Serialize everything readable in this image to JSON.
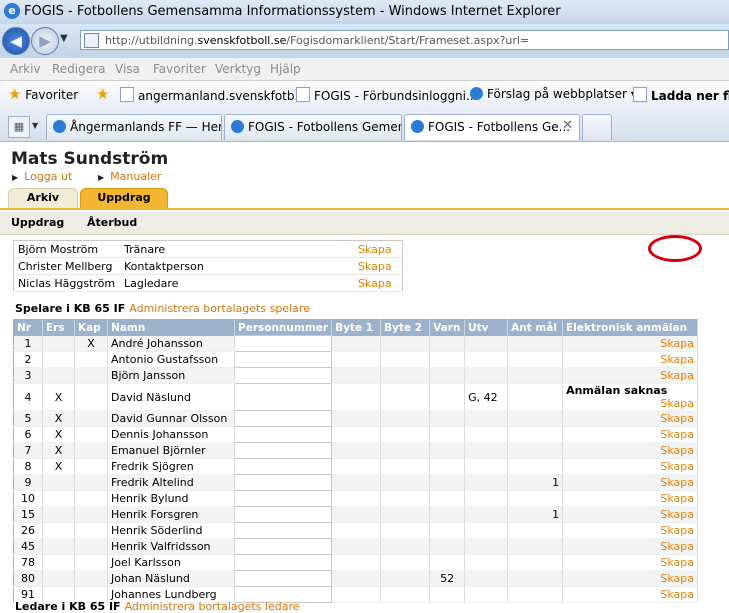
{
  "window": {
    "title": "FOGIS - Fotbollens Gemensamma Informationssystem - Windows Internet Explorer"
  },
  "address": {
    "prefix": "http://utbildning.",
    "domain": "svenskfotboll.se",
    "path": "/Fogisdomarklient/Start/Frameset.aspx?url="
  },
  "menu": [
    "Arkiv",
    "Redigera",
    "Visa",
    "Favoriter",
    "Verktyg",
    "Hjälp"
  ],
  "favorites": {
    "label": "Favoriter",
    "items": [
      "angermanland.svenskfotb...",
      "FOGIS - Förbundsinloggni...",
      "Förslag på webbplatser ▾",
      "Ladda ner fler"
    ]
  },
  "tabs": [
    "Ångermanlands FF — Hem",
    "FOGIS - Fotbollens Gemen...",
    "FOGIS - Fotbollens Ge..."
  ],
  "page": {
    "user_name": "Mats Sundström",
    "logout": "Logga ut",
    "manuals": "Manualer",
    "tab_arkiv": "Arkiv",
    "tab_uppdrag": "Uppdrag",
    "subnav": [
      "Uppdrag",
      "Återbud"
    ],
    "staff": [
      {
        "name": "Björn Moström",
        "role": "Tränare",
        "action": "Skapa"
      },
      {
        "name": "Christer Mellberg",
        "role": "Kontaktperson",
        "action": "Skapa"
      },
      {
        "name": "Niclas Häggström",
        "role": "Lagledare",
        "action": "Skapa"
      }
    ],
    "players_heading": "Spelare i KB 65 IF",
    "players_admin": "Administrera bortalagets spelare",
    "columns": [
      "Nr",
      "Ers",
      "Kap",
      "Namn",
      "Personnummer",
      "Byte 1",
      "Byte 2",
      "Varn",
      "Utv",
      "Ant mål",
      "Elektronisk anmälan"
    ],
    "players": [
      {
        "nr": "1",
        "ers": "",
        "kap": "X",
        "namn": "André Johansson",
        "varn": "",
        "utv": "",
        "mal": "",
        "anm": "",
        "action": "Skapa"
      },
      {
        "nr": "2",
        "ers": "",
        "kap": "",
        "namn": "Antonio Gustafsson",
        "varn": "",
        "utv": "",
        "mal": "",
        "anm": "",
        "action": "Skapa"
      },
      {
        "nr": "3",
        "ers": "",
        "kap": "",
        "namn": "Björn Jansson",
        "varn": "",
        "utv": "",
        "mal": "",
        "anm": "",
        "action": "Skapa"
      },
      {
        "nr": "4",
        "ers": "X",
        "kap": "",
        "namn": "David Näslund",
        "varn": "",
        "utv": "G, 42",
        "mal": "",
        "anm": "Anmälan saknas",
        "action": "Skapa"
      },
      {
        "nr": "5",
        "ers": "X",
        "kap": "",
        "namn": "David Gunnar Olsson",
        "varn": "",
        "utv": "",
        "mal": "",
        "anm": "",
        "action": "Skapa"
      },
      {
        "nr": "6",
        "ers": "X",
        "kap": "",
        "namn": "Dennis Johansson",
        "varn": "",
        "utv": "",
        "mal": "",
        "anm": "",
        "action": "Skapa"
      },
      {
        "nr": "7",
        "ers": "X",
        "kap": "",
        "namn": "Emanuel Björnler",
        "varn": "",
        "utv": "",
        "mal": "",
        "anm": "",
        "action": "Skapa"
      },
      {
        "nr": "8",
        "ers": "X",
        "kap": "",
        "namn": "Fredrik Sjögren",
        "varn": "",
        "utv": "",
        "mal": "",
        "anm": "",
        "action": "Skapa"
      },
      {
        "nr": "9",
        "ers": "",
        "kap": "",
        "namn": "Fredrik Altelind",
        "varn": "",
        "utv": "",
        "mal": "1",
        "anm": "",
        "action": "Skapa"
      },
      {
        "nr": "10",
        "ers": "",
        "kap": "",
        "namn": "Henrik Bylund",
        "varn": "",
        "utv": "",
        "mal": "",
        "anm": "",
        "action": "Skapa"
      },
      {
        "nr": "15",
        "ers": "",
        "kap": "",
        "namn": "Henrik Forsgren",
        "varn": "",
        "utv": "",
        "mal": "1",
        "anm": "",
        "action": "Skapa"
      },
      {
        "nr": "26",
        "ers": "",
        "kap": "",
        "namn": "Henrik Söderlind",
        "varn": "",
        "utv": "",
        "mal": "",
        "anm": "",
        "action": "Skapa"
      },
      {
        "nr": "45",
        "ers": "",
        "kap": "",
        "namn": "Henrik Valfridsson",
        "varn": "",
        "utv": "",
        "mal": "",
        "anm": "",
        "action": "Skapa"
      },
      {
        "nr": "78",
        "ers": "",
        "kap": "",
        "namn": "Joel Karlsson",
        "varn": "",
        "utv": "",
        "mal": "",
        "anm": "",
        "action": "Skapa"
      },
      {
        "nr": "80",
        "ers": "",
        "kap": "",
        "namn": "Johan Näslund",
        "varn": "52",
        "utv": "",
        "mal": "",
        "anm": "",
        "action": "Skapa"
      },
      {
        "nr": "91",
        "ers": "",
        "kap": "",
        "namn": "Johannes Lundberg",
        "varn": "",
        "utv": "",
        "mal": "",
        "anm": "",
        "action": "Skapa"
      }
    ],
    "leaders_heading": "Ledare i KB 65 IF",
    "leaders_admin": "Administrera bortalagets ledare"
  }
}
